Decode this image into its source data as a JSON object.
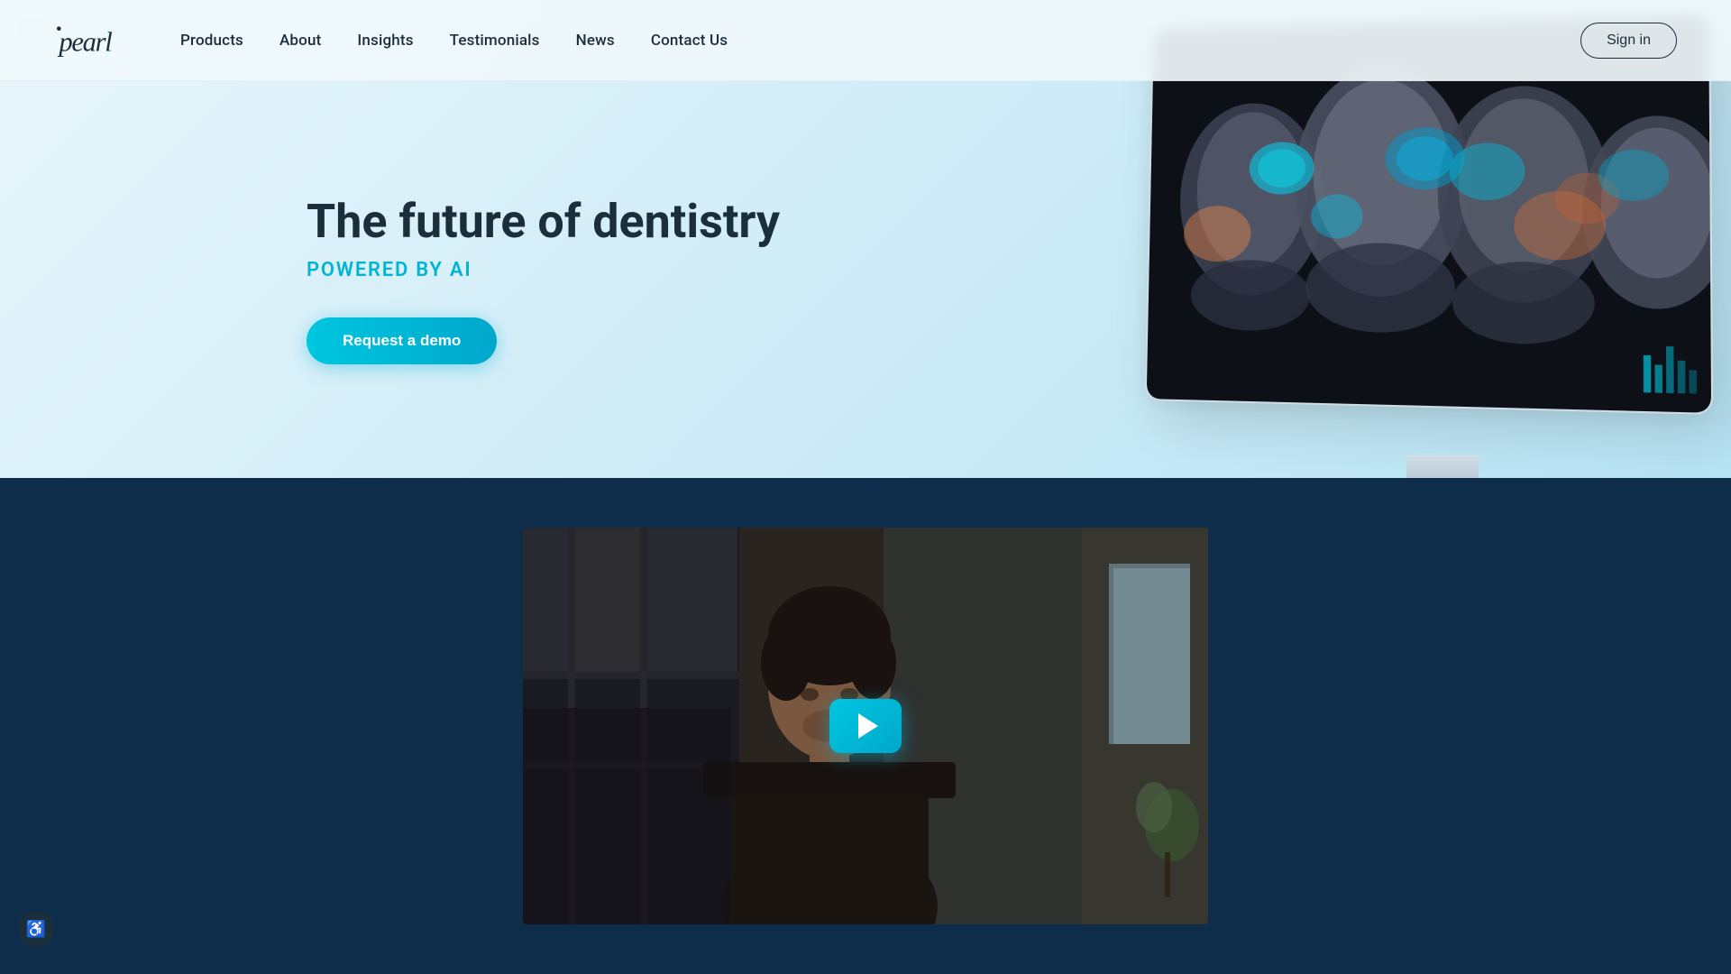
{
  "header": {
    "logo_alt": "Pearl logo",
    "nav": {
      "items": [
        {
          "label": "Products",
          "href": "#"
        },
        {
          "label": "About",
          "href": "#"
        },
        {
          "label": "Insights",
          "href": "#"
        },
        {
          "label": "Testimonials",
          "href": "#"
        },
        {
          "label": "News",
          "href": "#"
        },
        {
          "label": "Contact Us",
          "href": "#"
        }
      ]
    },
    "sign_in_label": "Sign in"
  },
  "hero": {
    "title": "The future of dentistry",
    "subtitle": "POWERED BY AI",
    "cta_label": "Request a demo"
  },
  "video": {
    "play_label": "Play video"
  },
  "accessibility": {
    "label": "Accessibility"
  }
}
